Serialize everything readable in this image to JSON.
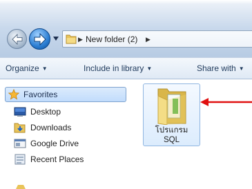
{
  "address_bar": {
    "path_segments": [
      "New folder (2)"
    ],
    "separator_glyph": "▶"
  },
  "toolbar": {
    "organize_label": "Organize",
    "include_label": "Include in library",
    "share_label": "Share with",
    "dropdown_glyph": "▼"
  },
  "nav_pane": {
    "favorites_label": "Favorites",
    "items": [
      {
        "label": "Desktop",
        "icon": "desktop-icon"
      },
      {
        "label": "Downloads",
        "icon": "downloads-icon"
      },
      {
        "label": "Google Drive",
        "icon": "google-drive-icon"
      },
      {
        "label": "Recent Places",
        "icon": "recent-places-icon"
      }
    ]
  },
  "files": [
    {
      "name": "โปรแกรม SQL",
      "line1": "โปรแกรม",
      "line2": "SQL",
      "icon": "folder-icon",
      "selected": true
    }
  ],
  "colors": {
    "annotation_arrow": "#e01010",
    "selection_border": "#7da2ce",
    "folder_yellow": "#f2d672"
  }
}
